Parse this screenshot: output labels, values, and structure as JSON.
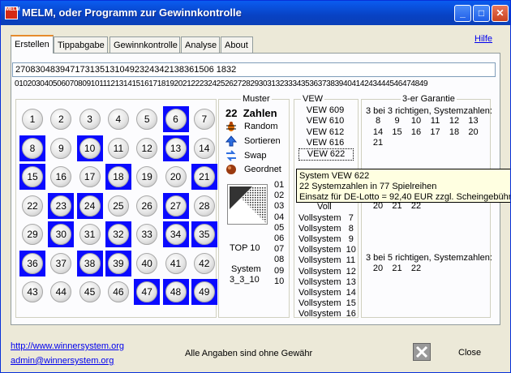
{
  "window": {
    "title": "MELM, oder Programm zur Gewinnkontrolle",
    "icon_text": "MELM"
  },
  "tabs": [
    {
      "label": "Erstellen",
      "active": true
    },
    {
      "label": "Tippabgabe",
      "active": false
    },
    {
      "label": "Gewinnkontrolle",
      "active": false
    },
    {
      "label": "Analyse",
      "active": false
    },
    {
      "label": "About",
      "active": false
    }
  ],
  "help_link": "Hilfe",
  "number_field": "2708304839471731351310492324342138361506 1832",
  "digit_row": "01020304050607080910111213141516171819202122232425262728293031323334353637383940414243444546474849",
  "grid": {
    "numbers": [
      1,
      2,
      3,
      4,
      5,
      6,
      7,
      8,
      9,
      10,
      11,
      12,
      13,
      14,
      15,
      16,
      17,
      18,
      19,
      20,
      21,
      22,
      23,
      24,
      25,
      26,
      27,
      28,
      29,
      30,
      31,
      32,
      33,
      34,
      35,
      36,
      37,
      38,
      39,
      40,
      41,
      42,
      43,
      44,
      45,
      46,
      47,
      48,
      49
    ],
    "selected": [
      6,
      8,
      10,
      13,
      15,
      18,
      21,
      23,
      24,
      27,
      30,
      32,
      34,
      35,
      36,
      38,
      39,
      47,
      48,
      49
    ]
  },
  "side": {
    "count": "22",
    "count_label": "Zahlen",
    "buttons": [
      {
        "label": "Random",
        "icon": "bug-icon"
      },
      {
        "label": "Sortieren",
        "icon": "arrow-up-icon"
      },
      {
        "label": "Swap",
        "icon": "swap-icon"
      },
      {
        "label": "Geordnet",
        "icon": "ordered-ball-icon"
      }
    ]
  },
  "muster": {
    "label": "Muster",
    "numbers": [
      "01",
      "02",
      "03",
      "04",
      "05",
      "06",
      "07",
      "08",
      "09",
      "10"
    ],
    "top10": "TOP 10",
    "system_line1": "System",
    "system_line2": "3_3_10"
  },
  "vew": {
    "label": "VEW",
    "items": [
      "VEW 609",
      "VEW 610",
      "VEW 612",
      "VEW 616",
      "VEW 622"
    ],
    "selected_index": 4
  },
  "voll": {
    "label": "Voll",
    "items": [
      "Vollsystem   7",
      "Vollsystem   8",
      "Vollsystem   9",
      "Vollsystem  10",
      "Vollsystem  11",
      "Vollsystem  12",
      "Vollsystem  13",
      "Vollsystem  14",
      "Vollsystem  15",
      "Vollsystem  16"
    ]
  },
  "garantie": {
    "label": "3-er Garantie",
    "heading1": "3 bei 3 richtigen, Systemzahlen:",
    "rows1": [
      [
        "8",
        "9",
        "10",
        "11",
        "12",
        "13"
      ],
      [
        "14",
        "15",
        "16",
        "17",
        "18",
        "20"
      ],
      [
        "21"
      ]
    ],
    "partial_row": [
      "20",
      "21",
      "22"
    ],
    "heading2": "3 bei 5 richtigen, Systemzahlen:",
    "rows2": [
      [
        "20",
        "21",
        "22"
      ]
    ]
  },
  "tooltip": {
    "line1": "System VEW 622",
    "line2": "22 Systemzahlen in 77 Spielreihen",
    "line3": "Einsatz für DE-Lotto = 92,40 EUR zzgl. Scheingebühren"
  },
  "footer": {
    "url": "http://www.winnersystem.org",
    "email": "admin@winnersystem.org",
    "disclaimer": "Alle Angaben sind ohne Gewähr",
    "close_label": "Close"
  }
}
